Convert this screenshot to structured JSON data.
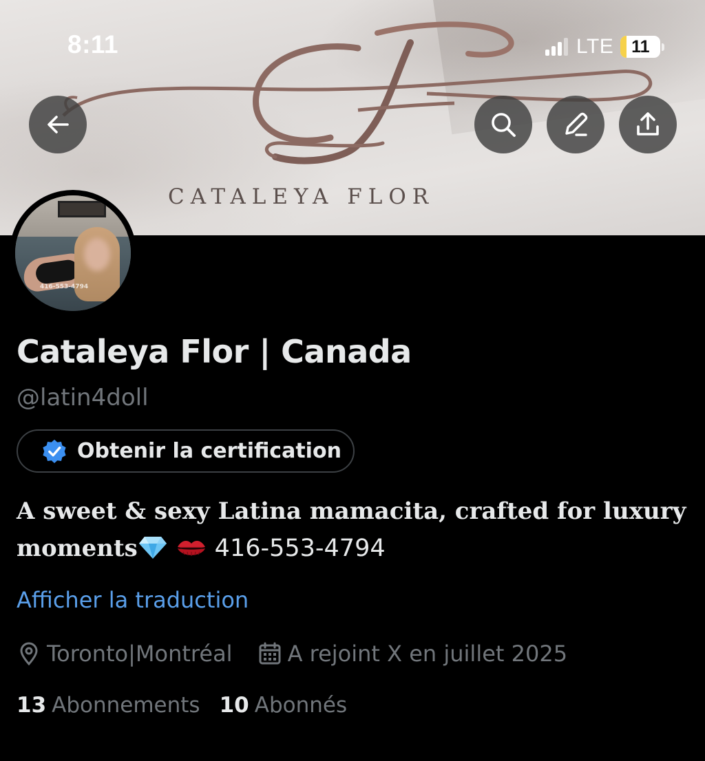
{
  "status_bar": {
    "time": "8:11",
    "network": "LTE",
    "battery": "11",
    "signal_bars_active": 3,
    "signal_bars_total": 4,
    "battery_level_percent": 11
  },
  "banner": {
    "brand_text": "CATALEYA FLOR",
    "logo_monogram": "CF",
    "monogram_color": "#8c6a62"
  },
  "avatar": {
    "watermark_text": "416-553-4794"
  },
  "profile": {
    "display_name": "Cataleya Flor | Canada",
    "handle": "@latin4doll",
    "certification_button": "Obtenir la certification",
    "bio_line1": "A sweet & sexy Latina mamacita, crafted for luxury",
    "bio_line2_text": "moments",
    "bio_phone": "416-553-4794",
    "bio_emojis": [
      "gem",
      "kiss-mark"
    ],
    "translate_link": "Afficher la traduction",
    "location": "Toronto|Montréal",
    "joined": "A rejoint X en juillet 2025",
    "following_count": "13",
    "following_label": "Abonnements",
    "followers_count": "10",
    "followers_label": "Abonnés"
  },
  "icons": {
    "back": "arrow-left-icon",
    "search": "search-icon",
    "edit": "pencil-icon",
    "share": "share-upload-icon",
    "verified": "verified-badge-icon",
    "location": "map-pin-icon",
    "calendar": "calendar-icon"
  },
  "colors": {
    "background": "#000000",
    "primary_text": "#e7e9ea",
    "secondary_text": "#71767b",
    "link": "#5a9fea",
    "verified_badge": "#3b8ff0",
    "banner_button": "#404040"
  }
}
